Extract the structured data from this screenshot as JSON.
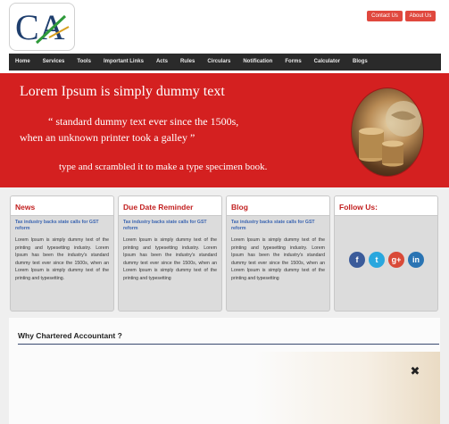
{
  "header": {
    "logo_text": "CA",
    "buttons": {
      "contact": "Contact Us",
      "about": "About Us"
    }
  },
  "nav": {
    "items": [
      "Home",
      "Services",
      "Tools",
      "Important Links",
      "Acts",
      "Rules",
      "Circulars",
      "Notification",
      "Forms",
      "Calculator",
      "Blogs"
    ]
  },
  "banner": {
    "title": "Lorem Ipsum is simply dummy text",
    "quote_line1": "“ standard dummy text ever since the 1500s,",
    "quote_line2": "when an unknown printer took a galley ”",
    "subline": "type and scrambled it to make a type specimen book."
  },
  "cards": {
    "news": {
      "title": "News",
      "link": "Tax industry backs state calls for GST reform",
      "body": "Lorem Ipsum is simply dummy text of the printing and typesetting industry. Lorem Ipsum has been the industry's standard dummy text ever since the 1500s, when an Lorem Ipsum is simply dummy text of the printing and typesetting."
    },
    "due_date": {
      "title": "Due Date Reminder",
      "link": "Tax industry backs state calls for GST reform",
      "body": "Lorem Ipsum is simply dummy text of the printing and typesetting industry. Lorem Ipsum has been the industry's standard dummy text ever since the 1500s, when an Lorem Ipsum is simply dummy text of the printing and typesetting"
    },
    "blog": {
      "title": "Blog",
      "link": "Tax industry backs state calls for GST reform",
      "body": "Lorem Ipsum is simply dummy text of the printing and typesetting industry. Lorem Ipsum has been the industry's standard dummy text ever since the 1500s, when an Lorem Ipsum is simply dummy text of the printing and typesetting"
    },
    "follow": {
      "title": "Follow Us:",
      "icons": {
        "facebook": "f",
        "twitter": "t",
        "googleplus": "g+",
        "linkedin": "in"
      }
    }
  },
  "why": {
    "title": "Why Chartered Accountant ?",
    "icon_glyph": "✖"
  },
  "colors": {
    "accent_red": "#d42020",
    "nav_bg": "#2a2a2a",
    "button_red": "#e0483e",
    "link_blue": "#3a64b0"
  }
}
